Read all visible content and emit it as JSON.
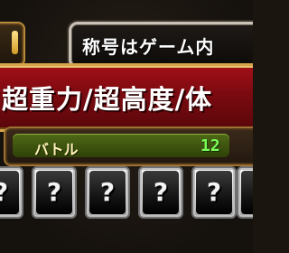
{
  "header": {
    "title_prefix": "称号はゲーム内"
  },
  "banner": {
    "text": "超重力/超高度/体"
  },
  "battle": {
    "label": "バトル",
    "count": "12"
  },
  "cards": [
    {
      "glyph": "?"
    },
    {
      "glyph": "?"
    },
    {
      "glyph": "?"
    },
    {
      "glyph": "?"
    },
    {
      "glyph": "?"
    },
    {
      "glyph": "?"
    }
  ],
  "colors": {
    "banner_red": "#8f0d14",
    "gold_trim": "#d6a44a",
    "battle_green": "#7dff5a"
  }
}
